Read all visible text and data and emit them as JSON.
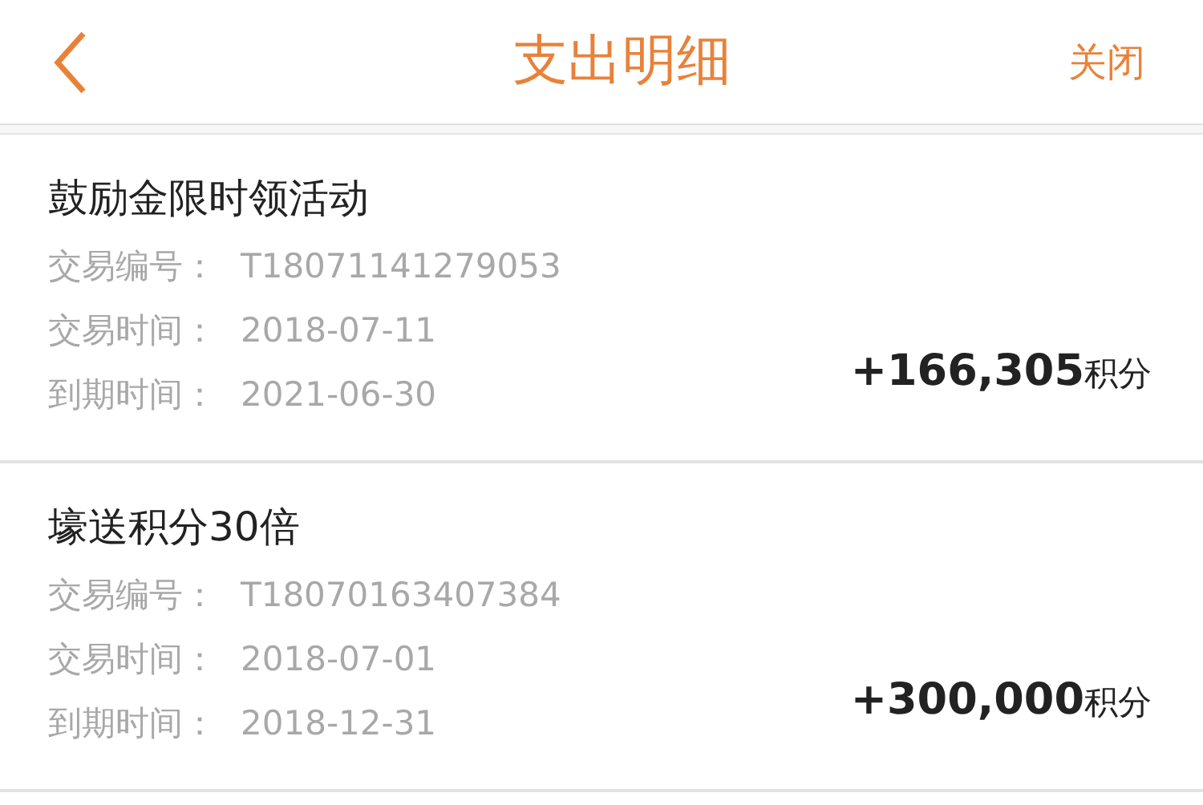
{
  "header": {
    "title": "支出明细",
    "close": "关闭"
  },
  "records": [
    {
      "title": "鼓励金限时领活动",
      "details": [
        {
          "label": "交易编号：",
          "value": "T18071141279053"
        },
        {
          "label": "交易时间：",
          "value": "2018-07-11"
        },
        {
          "label": "到期时间：",
          "value": "2021-06-30"
        }
      ],
      "amount": "+166,305",
      "unit": "积分"
    },
    {
      "title": "壕送积分30倍",
      "details": [
        {
          "label": "交易编号：",
          "value": "T18070163407384"
        },
        {
          "label": "交易时间：",
          "value": "2018-07-01"
        },
        {
          "label": "到期时间：",
          "value": "2018-12-31"
        }
      ],
      "amount": "+300,000",
      "unit": "积分"
    }
  ]
}
